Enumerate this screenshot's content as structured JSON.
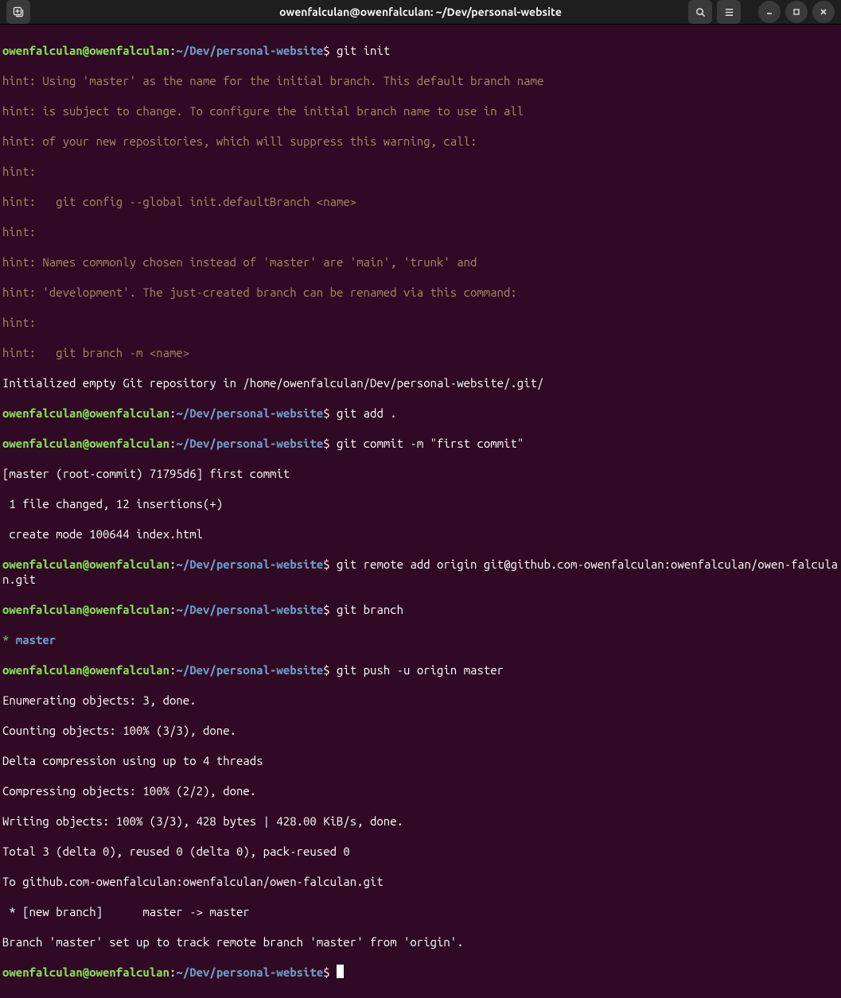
{
  "window": {
    "title": "owenfalculan@owenfalculan: ~/Dev/personal-website"
  },
  "prompt": {
    "userhost": "owenfalculan@owenfalculan",
    "colon": ":",
    "path": "~/Dev/personal-website",
    "dollar": "$ "
  },
  "commands": {
    "c1": "git init",
    "c2": "git add .",
    "c3": "git commit -m \"first commit\"",
    "c4": "git remote add origin git@github.com-owenfalculan:owenfalculan/owen-falculan.git",
    "c5": "git branch",
    "c6": "git push -u origin master",
    "c7": ""
  },
  "out": {
    "hint1": "hint: Using 'master' as the name for the initial branch. This default branch name",
    "hint2": "hint: is subject to change. To configure the initial branch name to use in all",
    "hint3": "hint: of your new repositories, which will suppress this warning, call:",
    "hint4": "hint: ",
    "hint5": "hint:   git config --global init.defaultBranch <name>",
    "hint6": "hint: ",
    "hint7": "hint: Names commonly chosen instead of 'master' are 'main', 'trunk' and",
    "hint8": "hint: 'development'. The just-created branch can be renamed via this command:",
    "hint9": "hint: ",
    "hint10": "hint:   git branch -m <name>",
    "init_done": "Initialized empty Git repository in /home/owenfalculan/Dev/personal-website/.git/",
    "commit1": "[master (root-commit) 71795d6] first commit",
    "commit2": " 1 file changed, 12 insertions(+)",
    "commit3": " create mode 100644 index.html",
    "branch_star": "* ",
    "branch_name": "master",
    "push1": "Enumerating objects: 3, done.",
    "push2": "Counting objects: 100% (3/3), done.",
    "push3": "Delta compression using up to 4 threads",
    "push4": "Compressing objects: 100% (2/2), done.",
    "push5": "Writing objects: 100% (3/3), 428 bytes | 428.00 KiB/s, done.",
    "push6": "Total 3 (delta 0), reused 0 (delta 0), pack-reused 0",
    "push7": "To github.com-owenfalculan:owenfalculan/owen-falculan.git",
    "push8": " * [new branch]      master -> master",
    "push9": "Branch 'master' set up to track remote branch 'master' from 'origin'."
  }
}
